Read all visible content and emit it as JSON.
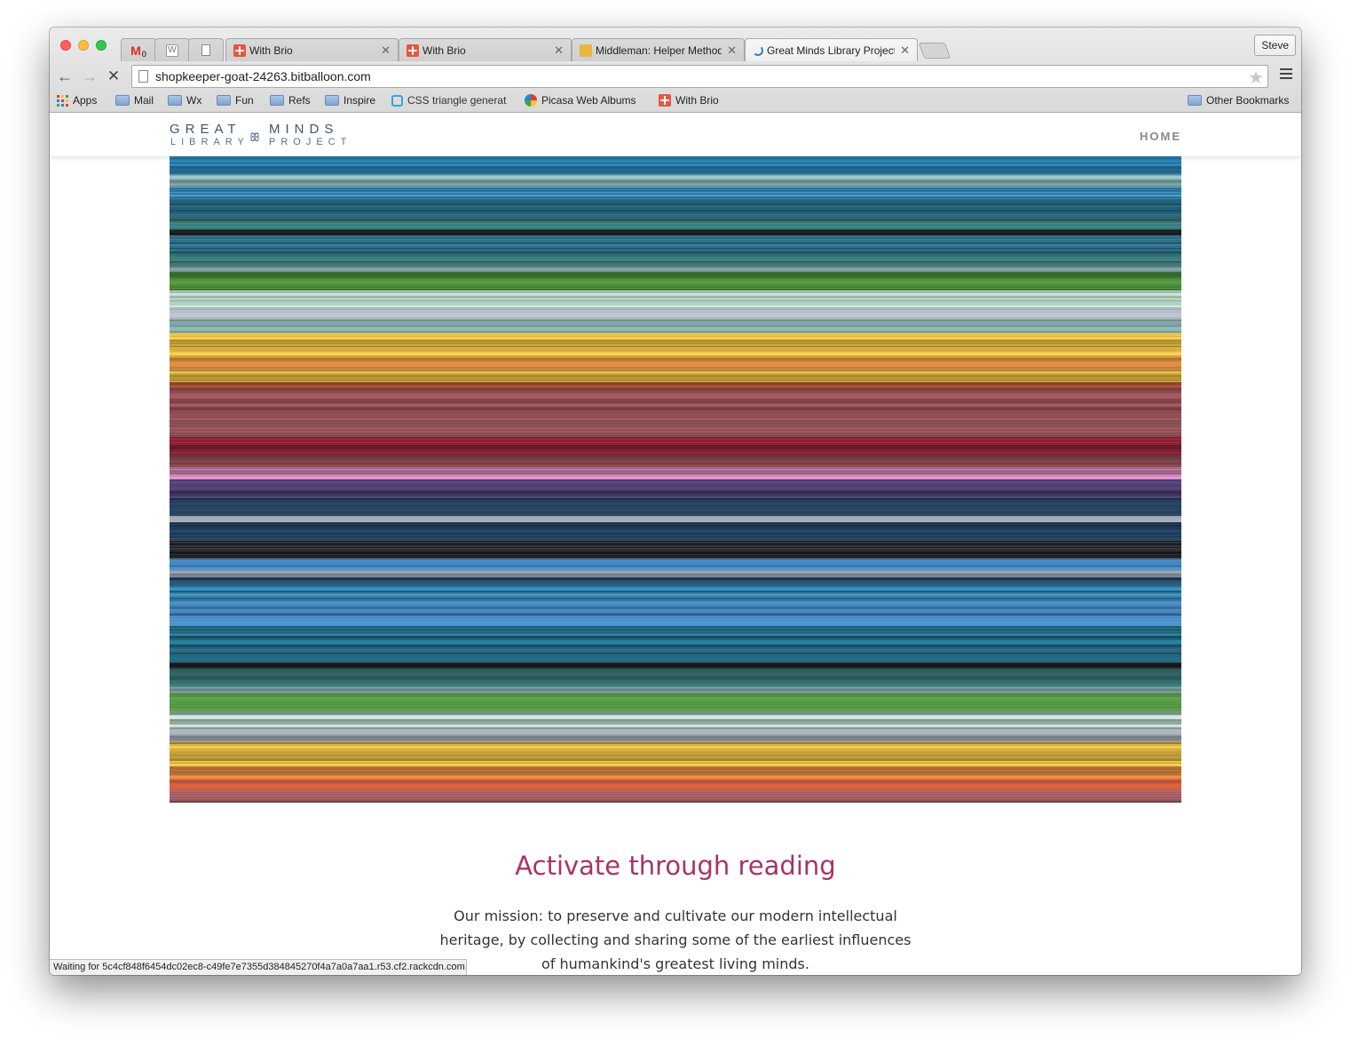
{
  "browser": {
    "tabs": [
      {
        "title": "With Brio",
        "icon": "brio-icon"
      },
      {
        "title": "With Brio",
        "icon": "brio-icon"
      },
      {
        "title": "Middleman: Helper Methods",
        "icon": "middleman-icon"
      },
      {
        "title": "Great Minds Library Project",
        "icon": "loading-spinner-icon",
        "active": true
      }
    ],
    "profile": "Steve",
    "url": "shopkeeper-goat-24263.bitballoon.com",
    "gmail_badge": "0",
    "bookmarks": [
      {
        "label": "Apps",
        "icon": "apps-icon"
      },
      {
        "label": "Mail",
        "icon": "folder-icon"
      },
      {
        "label": "Wx",
        "icon": "folder-icon"
      },
      {
        "label": "Fun",
        "icon": "folder-icon"
      },
      {
        "label": "Refs",
        "icon": "folder-icon"
      },
      {
        "label": "Inspire",
        "icon": "folder-icon"
      },
      {
        "label": "CSS triangle generat",
        "icon": "css-icon"
      },
      {
        "label": "Picasa Web Albums",
        "icon": "picasa-icon"
      },
      {
        "label": "With Brio",
        "icon": "brio-icon"
      }
    ],
    "other_bookmarks": "Other Bookmarks",
    "status": "Waiting for 5c4cf848f6454dc02ec8-c49fe7e7355d384845270f4a7a0a7aa1.r53.cf2.rackcdn.com..."
  },
  "site": {
    "logo": {
      "line1_left": "GREAT",
      "line1_right": "MINDS",
      "line2_left": "LIBRARY",
      "line2_right": "PROJECT"
    },
    "nav_home": "HOME",
    "tagline": "Activate through reading",
    "mission": "Our mission: to preserve and cultivate our modern intellectual heritage, by collecting and sharing some of the earliest influences of humankind's greatest living minds.",
    "hero_palette": [
      "#2a7fb0",
      "#1f5f78",
      "#2e6b6b",
      "#7fa8a6",
      "#9aa3ad",
      "#e0b43a",
      "#e58e3a",
      "#8a4a4f",
      "#7b1a2d",
      "#c97ab0",
      "#4a3a6a",
      "#1c3a5a",
      "#1b1e24",
      "#3f80b8",
      "#1d6e8a",
      "#4a8a3a",
      "#a9c4b8",
      "#c85a3a"
    ]
  }
}
